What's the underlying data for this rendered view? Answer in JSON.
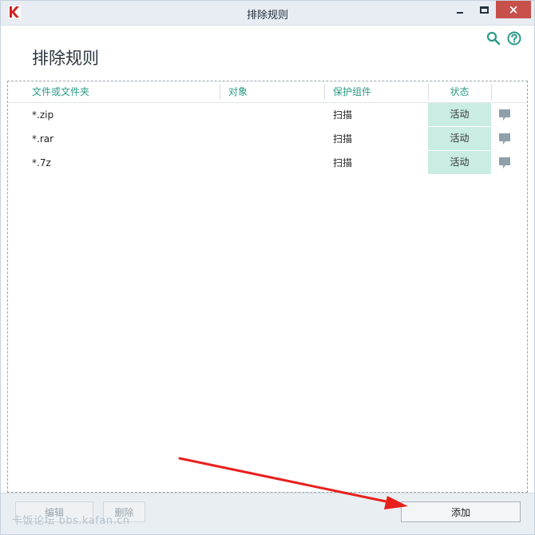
{
  "window": {
    "title": "排除规则",
    "close_glyph": "×"
  },
  "header": {
    "title": "排除规则",
    "icons": [
      "search-icon",
      "help-icon"
    ]
  },
  "table": {
    "columns": [
      "文件或文件夹",
      "对象",
      "保护组件",
      "状态"
    ],
    "rows": [
      {
        "path": "*.zip",
        "object": "",
        "component": "扫描",
        "status": "活动"
      },
      {
        "path": "*.rar",
        "object": "",
        "component": "扫描",
        "status": "活动"
      },
      {
        "path": "*.7z",
        "object": "",
        "component": "扫描",
        "status": "活动"
      }
    ]
  },
  "footer": {
    "edit_label": "编辑",
    "delete_label": "删除",
    "add_label": "添加",
    "watermark": "卡饭论坛 bbs.kafan.cn"
  },
  "colors": {
    "accent": "#2a9b86",
    "status_bg": "#c9ece3",
    "close_bg": "#c7504b",
    "arrow": "#e8201c"
  }
}
